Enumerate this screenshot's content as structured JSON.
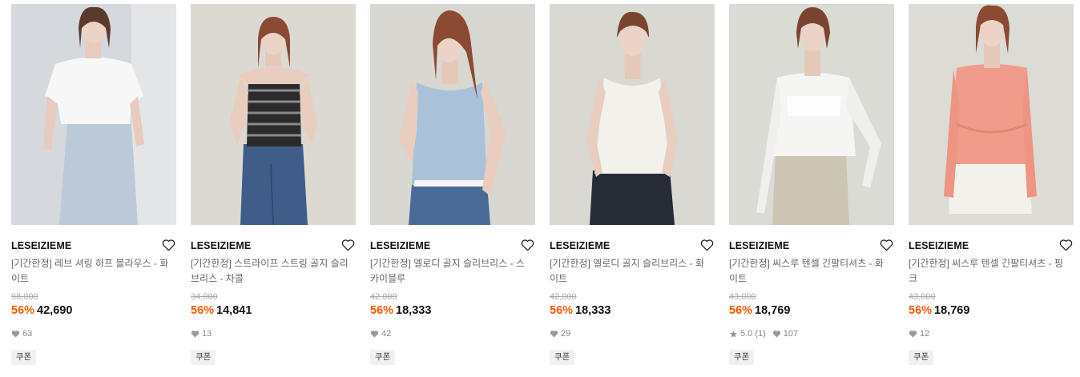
{
  "products": [
    {
      "brand": "LESEIZIEME",
      "name": "[기간한정] 레브 셔링 하프 블라우스 - 화이트",
      "original_price": "98,000",
      "discount": "56%",
      "price": "42,690",
      "rating": "",
      "likes": "63",
      "coupon": "쿠폰"
    },
    {
      "brand": "LESEIZIEME",
      "name": "[기간한정] 스트라이프 스트링 골지 슬리브리스 - 차콜",
      "original_price": "34,000",
      "discount": "56%",
      "price": "14,841",
      "rating": "",
      "likes": "13",
      "coupon": "쿠폰"
    },
    {
      "brand": "LESEIZIEME",
      "name": "[기간한정] 엘로디 골지 슬리브리스 - 스카이블루",
      "original_price": "42,000",
      "discount": "56%",
      "price": "18,333",
      "rating": "",
      "likes": "42",
      "coupon": "쿠폰"
    },
    {
      "brand": "LESEIZIEME",
      "name": "[기간한정] 엘로디 골지 슬리브리스 - 화이트",
      "original_price": "42,000",
      "discount": "56%",
      "price": "18,333",
      "rating": "",
      "likes": "29",
      "coupon": "쿠폰"
    },
    {
      "brand": "LESEIZIEME",
      "name": "[기간한정] 씨스루 텐셀 긴팔티셔츠 - 화이트",
      "original_price": "43,000",
      "discount": "56%",
      "price": "18,769",
      "rating": "5.0 (1)",
      "likes": "107",
      "coupon": "쿠폰"
    },
    {
      "brand": "LESEIZIEME",
      "name": "[기간한정] 씨스루 텐셀 긴팔티셔츠 - 핑크",
      "original_price": "43,000",
      "discount": "56%",
      "price": "18,769",
      "rating": "",
      "likes": "12",
      "coupon": "쿠폰"
    }
  ],
  "colors": {
    "discount": "#ff5a00",
    "brand_text": "#111111",
    "meta_icon": "#999999",
    "coupon_bg": "#f1f1f1"
  },
  "icons": {
    "wishlist": "heart-outline-icon",
    "likes": "heart-filled-icon",
    "rating": "star-icon"
  }
}
